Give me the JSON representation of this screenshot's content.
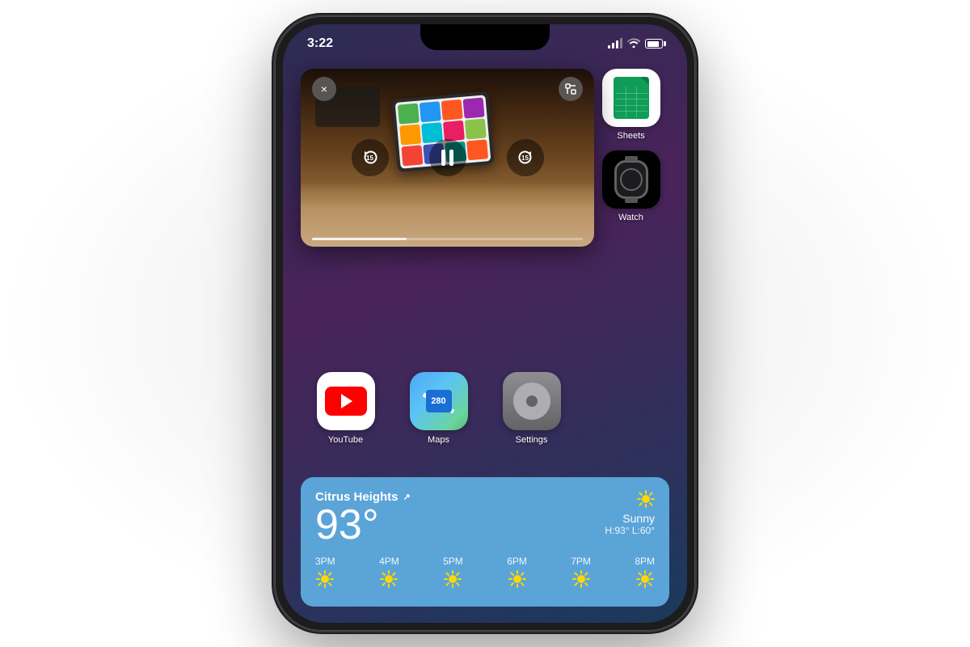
{
  "status_bar": {
    "time": "3:22",
    "location_active": true
  },
  "pip": {
    "close_label": "×",
    "expand_label": "⤢",
    "rewind_label": "15",
    "forward_label": "15",
    "progress_percent": 35
  },
  "apps": [
    {
      "id": "youtube",
      "label": "YouTube"
    },
    {
      "id": "maps",
      "label": "Maps"
    },
    {
      "id": "settings",
      "label": "Settings"
    },
    {
      "id": "watch",
      "label": "Watch"
    }
  ],
  "right_apps": [
    {
      "id": "sheets",
      "label": "Sheets"
    }
  ],
  "weather": {
    "location": "Citrus Heights",
    "temperature": "93°",
    "condition": "Sunny",
    "high": "H:93°",
    "low": "L:60°",
    "hourly": [
      {
        "time": "3PM",
        "icon": "sun"
      },
      {
        "time": "4PM",
        "icon": "sun"
      },
      {
        "time": "5PM",
        "icon": "sun"
      },
      {
        "time": "6PM",
        "icon": "sun"
      },
      {
        "time": "7PM",
        "icon": "sun"
      },
      {
        "time": "8PM",
        "icon": "sun"
      }
    ]
  }
}
